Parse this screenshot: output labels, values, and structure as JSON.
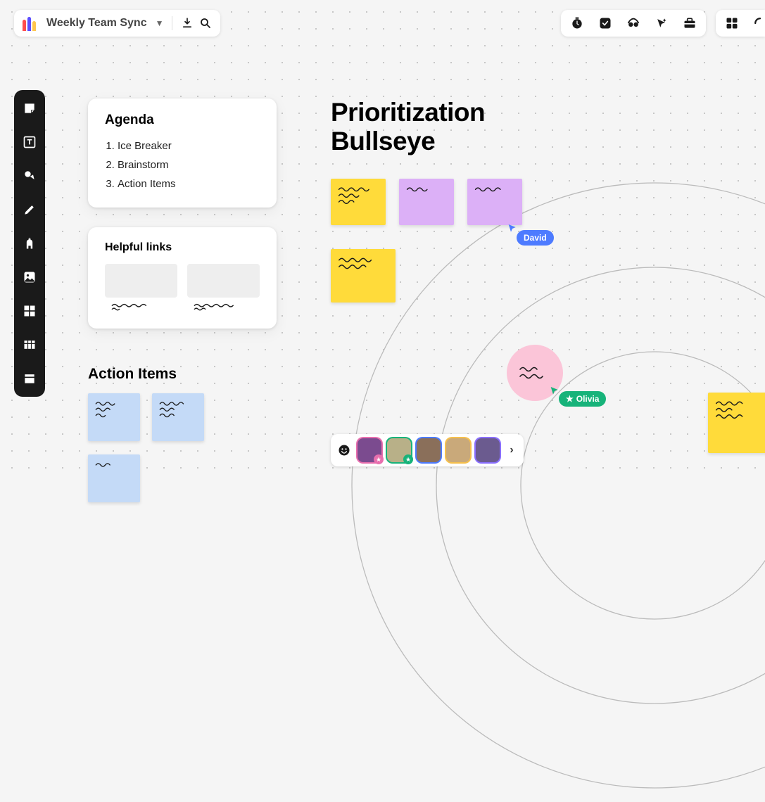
{
  "header": {
    "board_title": "Weekly Team Sync"
  },
  "cards": {
    "agenda": {
      "heading": "Agenda",
      "items": [
        "Ice Breaker",
        "Brainstorm",
        "Action Items"
      ]
    },
    "links": {
      "heading": "Helpful links"
    },
    "action_items_heading": "Action Items"
  },
  "canvas": {
    "heading_line1": "Prioritization",
    "heading_line2": "Bullseye"
  },
  "cursors": {
    "david": {
      "name": "David",
      "color": "#4d7bff"
    },
    "olivia": {
      "name": "Olivia",
      "color": "#17b37a"
    }
  },
  "stickies": {
    "yellow": "#ffdb3a",
    "purple": "#dcb0f7",
    "blue": "#c4daf7"
  },
  "avatars": [
    {
      "bg": "#7b4b8f",
      "ring": "#e86fae",
      "badge": "#e86fae"
    },
    {
      "bg": "#b8b088",
      "ring": "#17b37a",
      "badge": "#17b37a"
    },
    {
      "bg": "#8a6f5a",
      "ring": "#4d7bff",
      "badge": null
    },
    {
      "bg": "#c9a97a",
      "ring": "#f6c04d",
      "badge": null
    },
    {
      "bg": "#6b5b8f",
      "ring": "#8a6fff",
      "badge": null
    }
  ]
}
